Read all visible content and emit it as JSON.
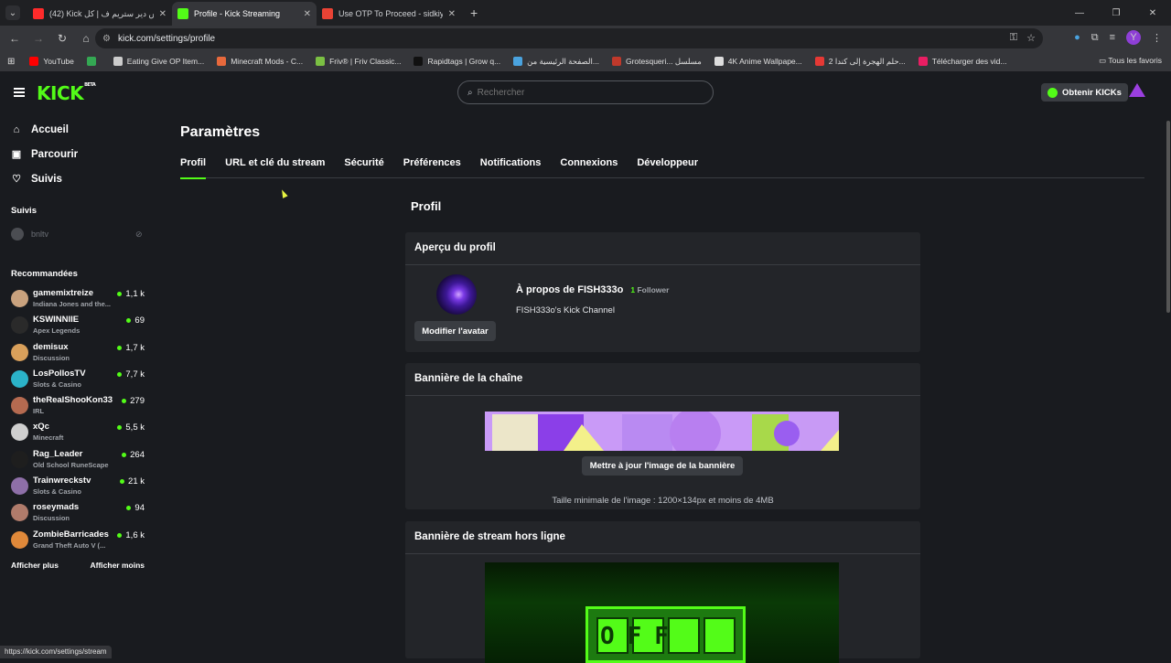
{
  "browser": {
    "tabs": [
      {
        "title": "(42) Kick كيفاش دير ستريم ف | كل",
        "fav_color": "#ff2b2b",
        "active": false
      },
      {
        "title": "Profile - Kick Streaming",
        "fav_color": "#53fc18",
        "active": true
      },
      {
        "title": "Use OTP To Proceed - sidkiyoun",
        "fav_color": "#ea4335",
        "active": false
      }
    ],
    "url": "kick.com/settings/profile",
    "profile_initial": "Y",
    "bookmarks": [
      {
        "label": "YouTube",
        "color": "#ff0000"
      },
      {
        "label": "",
        "color": "#34a853"
      },
      {
        "label": "Eating Give OP Item...",
        "color": "#cccccc"
      },
      {
        "label": "Minecraft Mods - C...",
        "color": "#e8693c"
      },
      {
        "label": "Friv® | Friv Classic...",
        "color": "#7bc043"
      },
      {
        "label": "Rapidtags | Grow q...",
        "color": "#111111"
      },
      {
        "label": "الصفحة الرئيسية من...",
        "color": "#4aa3df"
      },
      {
        "label": "Grotesqueri... مسلسل",
        "color": "#c0392b"
      },
      {
        "label": "4K Anime Wallpape...",
        "color": "#dddddd"
      },
      {
        "label": "حلم الهجرة إلى كندا 2...",
        "color": "#e53935"
      },
      {
        "label": "Télécharger des vid...",
        "color": "#e91e63"
      }
    ],
    "all_bookmarks": "Tous les favoris",
    "status_url": "https://kick.com/settings/stream"
  },
  "header": {
    "logo": "KICK",
    "beta": "BETA",
    "search_placeholder": "Rechercher",
    "get_kicks": "Obtenir KICKs"
  },
  "sidebar": {
    "nav": [
      {
        "label": "Accueil",
        "icon": "home-icon"
      },
      {
        "label": "Parcourir",
        "icon": "browse-icon"
      },
      {
        "label": "Suivis",
        "icon": "heart-icon"
      }
    ],
    "followed_title": "Suivis",
    "followed": [
      {
        "name": "bnltv"
      }
    ],
    "recommended_title": "Recommandées",
    "recommended": [
      {
        "name": "gamemixtreize",
        "category": "Indiana Jones and the...",
        "viewers": "1,1 k",
        "color": "#c9a27e"
      },
      {
        "name": "KSWINNIIE",
        "category": "Apex Legends",
        "viewers": "69",
        "color": "#2a2a2a"
      },
      {
        "name": "demisux",
        "category": "Discussion",
        "viewers": "1,7 k",
        "color": "#d9a05b"
      },
      {
        "name": "LosPollosTV",
        "category": "Slots & Casino",
        "viewers": "7,7 k",
        "color": "#2bb3c9"
      },
      {
        "name": "theRealShooKon33",
        "category": "IRL",
        "viewers": "279",
        "color": "#b56a50"
      },
      {
        "name": "xQc",
        "category": "Minecraft",
        "viewers": "5,5 k",
        "color": "#cfcfcf"
      },
      {
        "name": "Rag_Leader",
        "category": "Old School RuneScape",
        "viewers": "264",
        "color": "#1e1e1e"
      },
      {
        "name": "Trainwreckstv",
        "category": "Slots & Casino",
        "viewers": "21 k",
        "color": "#8e6fa8"
      },
      {
        "name": "roseymads",
        "category": "Discussion",
        "viewers": "94",
        "color": "#b07b6b"
      },
      {
        "name": "ZombieBarricades",
        "category": "Grand Theft Auto V (...",
        "viewers": "1,6 k",
        "color": "#e0893a"
      }
    ],
    "show_more": "Afficher plus",
    "show_less": "Afficher moins"
  },
  "main": {
    "title": "Paramètres",
    "tabs": [
      "Profil",
      "URL et clé du stream",
      "Sécurité",
      "Préférences",
      "Notifications",
      "Connexions",
      "Développeur"
    ],
    "section_title": "Profil",
    "preview": {
      "title": "Aperçu du profil",
      "edit_avatar": "Modifier l'avatar",
      "about": "À propos de FISH333o",
      "followers_count": "1",
      "followers_label": "Follower",
      "description": "FISH333o's Kick Channel"
    },
    "banner": {
      "title": "Bannière de la chaîne",
      "update_button": "Mettre à jour l'image de la bannière",
      "note": "Taille minimale de l'image : 1200×134px et moins de 4MB"
    },
    "offline": {
      "title": "Bannière de stream hors ligne",
      "image_text": "OFF"
    }
  }
}
